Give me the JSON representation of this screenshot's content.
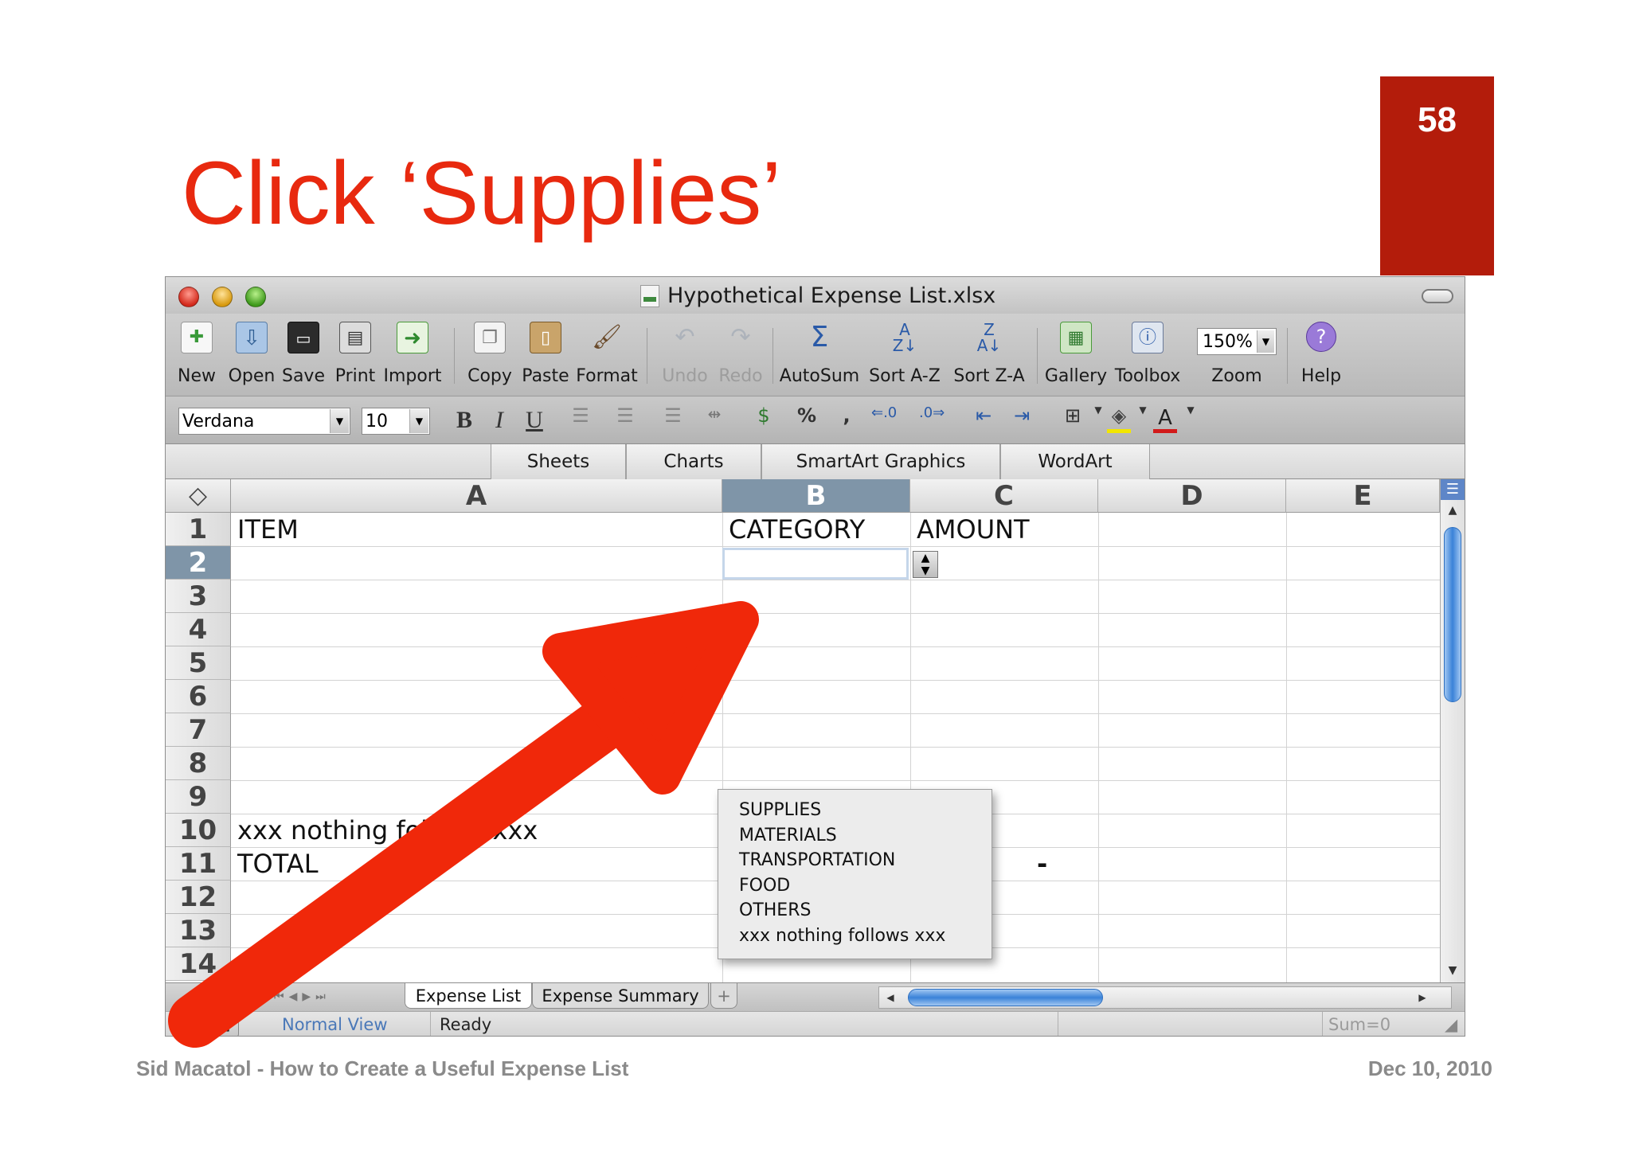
{
  "slide": {
    "title": "Click ‘Supplies’",
    "page_number": "58",
    "footer_left": "Sid Macatol - How to Create a Useful Expense List",
    "footer_right": "Dec 10, 2010"
  },
  "window": {
    "title": "Hypothetical Expense List.xlsx"
  },
  "toolbar": {
    "buttons": [
      {
        "label": "New",
        "icon": "new-document-icon",
        "enabled": true
      },
      {
        "label": "Open",
        "icon": "open-folder-icon",
        "enabled": true
      },
      {
        "label": "Save",
        "icon": "floppy-disk-icon",
        "enabled": true
      },
      {
        "label": "Print",
        "icon": "printer-icon",
        "enabled": true
      },
      {
        "label": "Import",
        "icon": "import-icon",
        "enabled": true
      },
      {
        "label": "Copy",
        "icon": "copy-icon",
        "enabled": true
      },
      {
        "label": "Paste",
        "icon": "paste-icon",
        "enabled": true
      },
      {
        "label": "Format",
        "icon": "format-brush-icon",
        "enabled": true
      },
      {
        "label": "Undo",
        "icon": "undo-icon",
        "enabled": false
      },
      {
        "label": "Redo",
        "icon": "redo-icon",
        "enabled": false
      },
      {
        "label": "AutoSum",
        "icon": "sigma-icon",
        "enabled": true
      },
      {
        "label": "Sort A-Z",
        "icon": "sort-ascending-icon",
        "enabled": true
      },
      {
        "label": "Sort Z-A",
        "icon": "sort-descending-icon",
        "enabled": true
      },
      {
        "label": "Gallery",
        "icon": "gallery-icon",
        "enabled": true
      },
      {
        "label": "Toolbox",
        "icon": "toolbox-icon",
        "enabled": true
      },
      {
        "label": "Zoom",
        "icon": "zoom-icon",
        "enabled": true
      },
      {
        "label": "Help",
        "icon": "help-icon",
        "enabled": true
      }
    ],
    "zoom_value": "150%"
  },
  "formatting": {
    "font_name": "Verdana",
    "font_size": "10",
    "bold": "B",
    "italic": "I",
    "underline": "U",
    "percent": "%",
    "comma": ",",
    "font_color_letter": "A"
  },
  "ribbon_tabs": [
    "Sheets",
    "Charts",
    "SmartArt Graphics",
    "WordArt"
  ],
  "grid": {
    "columns": [
      "A",
      "B",
      "C",
      "D",
      "E"
    ],
    "selected_column": "B",
    "rows": [
      "1",
      "2",
      "3",
      "4",
      "5",
      "6",
      "7",
      "8",
      "9",
      "10",
      "11",
      "12",
      "13",
      "14"
    ],
    "selected_row": "2",
    "cells": {
      "A1": "ITEM",
      "B1": "CATEGORY",
      "C1": "AMOUNT",
      "A10": "xxx nothing follows xxx",
      "A11": "TOTAL",
      "C11": "-"
    }
  },
  "dropdown": {
    "options": [
      "SUPPLIES",
      "MATERIALS",
      "TRANSPORTATION",
      "FOOD",
      "OTHERS",
      "xxx nothing follows xxx"
    ]
  },
  "sheet_tabs": [
    {
      "label": "Expense List",
      "active": true
    },
    {
      "label": "Expense Summary",
      "active": false
    }
  ],
  "add_sheet": "+",
  "status": {
    "view": "Normal View",
    "state": "Ready",
    "sum": "Sum=0"
  },
  "colors": {
    "title_red": "#e8290f",
    "page_box": "#b31c0b",
    "arrow": "#f0280a",
    "selection_header": "#7f95a8"
  }
}
